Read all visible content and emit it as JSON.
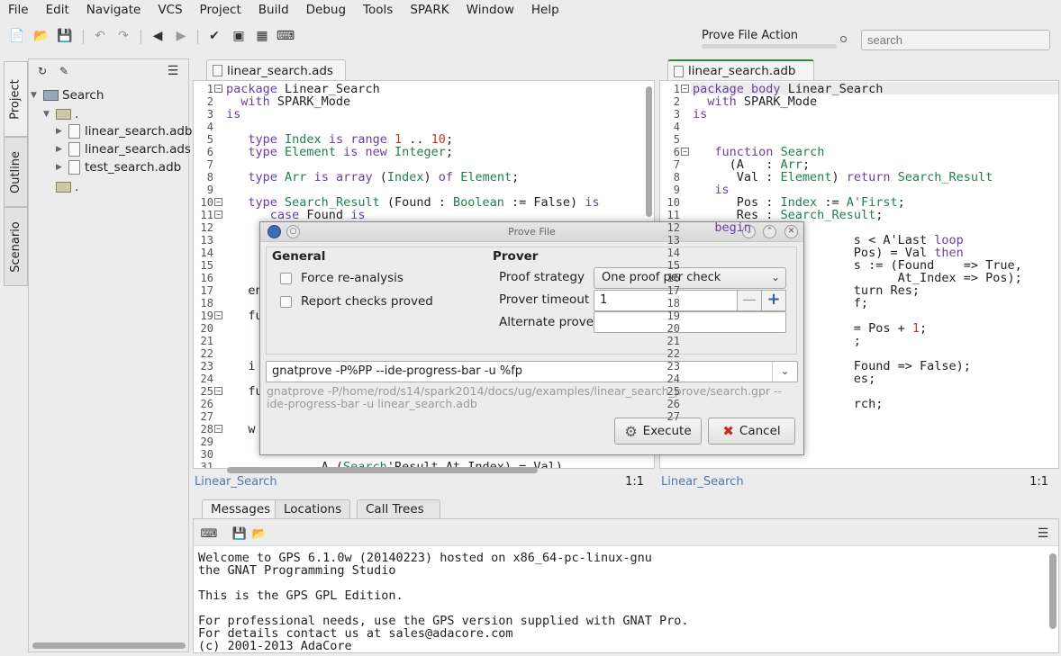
{
  "menu": [
    "File",
    "Edit",
    "Navigate",
    "VCS",
    "Project",
    "Build",
    "Debug",
    "Tools",
    "SPARK",
    "Window",
    "Help"
  ],
  "toolbar": {
    "task_label": "Prove File Action",
    "task_progress": 0.0,
    "search_placeholder": "search"
  },
  "side_tabs": [
    "Project",
    "Outline",
    "Scenario"
  ],
  "project_tree": {
    "root": "Search",
    "folder1": ".",
    "files": [
      "linear_search.adb",
      "linear_search.ads",
      "test_search.adb"
    ],
    "folder2": "."
  },
  "editor_left": {
    "tab": "linear_search.ads",
    "status_name": "Linear_Search",
    "status_pos": "1:1",
    "lines": [
      {
        "n": "1",
        "text": "package Linear_Search"
      },
      {
        "n": "2",
        "text": "  with SPARK_Mode"
      },
      {
        "n": "3",
        "text": "is"
      },
      {
        "n": "4",
        "text": ""
      },
      {
        "n": "5",
        "text": "   type Index is range 1 .. 10;"
      },
      {
        "n": "6",
        "text": "   type Element is new Integer;"
      },
      {
        "n": "7",
        "text": ""
      },
      {
        "n": "8",
        "text": "   type Arr is array (Index) of Element;"
      },
      {
        "n": "9",
        "text": ""
      },
      {
        "n": "10",
        "text": "   type Search_Result (Found : Boolean := False) is"
      },
      {
        "n": "11",
        "text": "      case Found is"
      },
      {
        "n": "12",
        "text": ""
      },
      {
        "n": "13",
        "text": ""
      },
      {
        "n": "14",
        "text": ""
      },
      {
        "n": "15",
        "text": ""
      },
      {
        "n": "16",
        "text": ""
      },
      {
        "n": "17",
        "text": "   en"
      },
      {
        "n": "18",
        "text": ""
      },
      {
        "n": "19",
        "text": "   fu"
      },
      {
        "n": "20",
        "text": ""
      },
      {
        "n": "21",
        "text": ""
      },
      {
        "n": "22",
        "text": ""
      },
      {
        "n": "23",
        "text": "   i"
      },
      {
        "n": "24",
        "text": ""
      },
      {
        "n": "25",
        "text": "   fu"
      },
      {
        "n": "26",
        "text": ""
      },
      {
        "n": "27",
        "text": ""
      },
      {
        "n": "28",
        "text": "   w"
      },
      {
        "n": "29",
        "text": ""
      },
      {
        "n": "30",
        "text": ""
      },
      {
        "n": "31",
        "text": "             A (Search'Result.At_Index) = Val)"
      }
    ]
  },
  "editor_right": {
    "tab": "linear_search.adb",
    "status_name": "Linear_Search",
    "status_pos": "1:1",
    "lines": [
      {
        "n": "1",
        "text": "package body Linear_Search"
      },
      {
        "n": "2",
        "text": "  with SPARK_Mode"
      },
      {
        "n": "3",
        "text": "is"
      },
      {
        "n": "4",
        "text": ""
      },
      {
        "n": "5",
        "text": ""
      },
      {
        "n": "6",
        "text": "   function Search"
      },
      {
        "n": "7",
        "text": "     (A   : Arr;"
      },
      {
        "n": "8",
        "text": "      Val : Element) return Search_Result"
      },
      {
        "n": "9",
        "text": "   is"
      },
      {
        "n": "10",
        "text": "      Pos : Index := A'First;"
      },
      {
        "n": "11",
        "text": "      Res : Search_Result;"
      },
      {
        "n": "12",
        "text": "   begin"
      },
      {
        "n": "13",
        "text": "                      s < A'Last loop"
      },
      {
        "n": "14",
        "text": "                      Pos) = Val then"
      },
      {
        "n": "15",
        "text": "                      s := (Found    => True,"
      },
      {
        "n": "16",
        "text": "                            At_Index => Pos);"
      },
      {
        "n": "17",
        "text": "                      turn Res;"
      },
      {
        "n": "18",
        "text": "                      f;"
      },
      {
        "n": "19",
        "text": ""
      },
      {
        "n": "20",
        "text": "                      = Pos + 1;"
      },
      {
        "n": "21",
        "text": "                      ;"
      },
      {
        "n": "22",
        "text": ""
      },
      {
        "n": "23",
        "text": "                      Found => False);"
      },
      {
        "n": "24",
        "text": "                      es;"
      },
      {
        "n": "25",
        "text": ""
      },
      {
        "n": "26",
        "text": "                      rch;"
      },
      {
        "n": "27",
        "text": ""
      }
    ]
  },
  "bottom_tabs": [
    "Messages",
    "Locations",
    "Call Trees"
  ],
  "messages": [
    "Welcome to GPS 6.1.0w (20140223) hosted on x86_64-pc-linux-gnu",
    "the GNAT Programming Studio",
    "",
    "This is the GPS GPL Edition.",
    "",
    "For professional needs, use the GPS version supplied with GNAT Pro.",
    "For details contact us at sales@adacore.com",
    "(c) 2001-2013 AdaCore"
  ],
  "dialog": {
    "title": "Prove File",
    "general_heading": "General",
    "prover_heading": "Prover",
    "force_reanalysis": "Force re-analysis",
    "report_checks": "Report checks proved",
    "proof_strategy_label": "Proof strategy",
    "proof_strategy_value": "One proof per check",
    "prover_timeout_label": "Prover timeout",
    "prover_timeout_value": "1",
    "alternate_prover_label": "Alternate prover",
    "alternate_prover_value": "",
    "command": "gnatprove -P%PP --ide-progress-bar -u %fp",
    "command_preview_1": "gnatprove -P/home/rod/s14/spark2014/docs/ug/examples/linear_search_prove/search.gpr --",
    "command_preview_2": "ide-progress-bar -u linear_search.adb",
    "execute": "Execute",
    "cancel": "Cancel"
  }
}
